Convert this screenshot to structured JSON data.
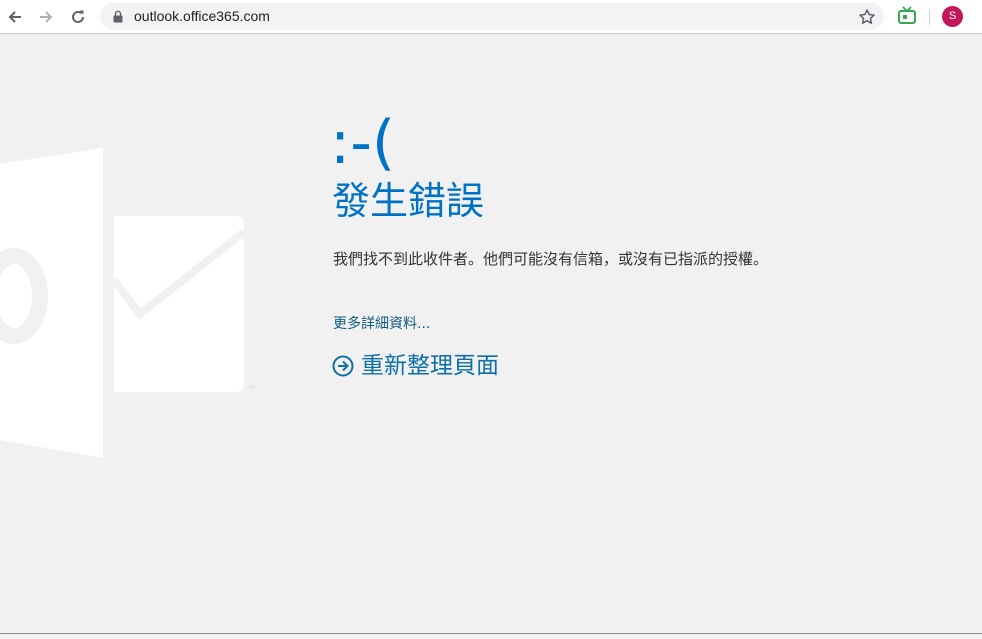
{
  "browser": {
    "url": "outlook.office365.com",
    "avatar_letter": "S",
    "avatar_color": "#c2185b",
    "extension_color": "#34a853",
    "icons": {
      "back": "arrow-left-icon",
      "forward": "arrow-right-icon",
      "reload": "reload-icon",
      "lock": "lock-icon",
      "bookmark": "star-icon",
      "extension": "tv-icon"
    }
  },
  "error": {
    "emoticon": ":-(",
    "title": "發生錯誤",
    "message": "我們找不到此收件者。他們可能沒有信箱，或沒有已指派的授權。",
    "more_details": "更多詳細資料...",
    "refresh": "重新整理頁面",
    "accent_color": "#0072c6"
  },
  "background_logo": {
    "icon": "outlook-logo-icon",
    "trademark": "™"
  }
}
